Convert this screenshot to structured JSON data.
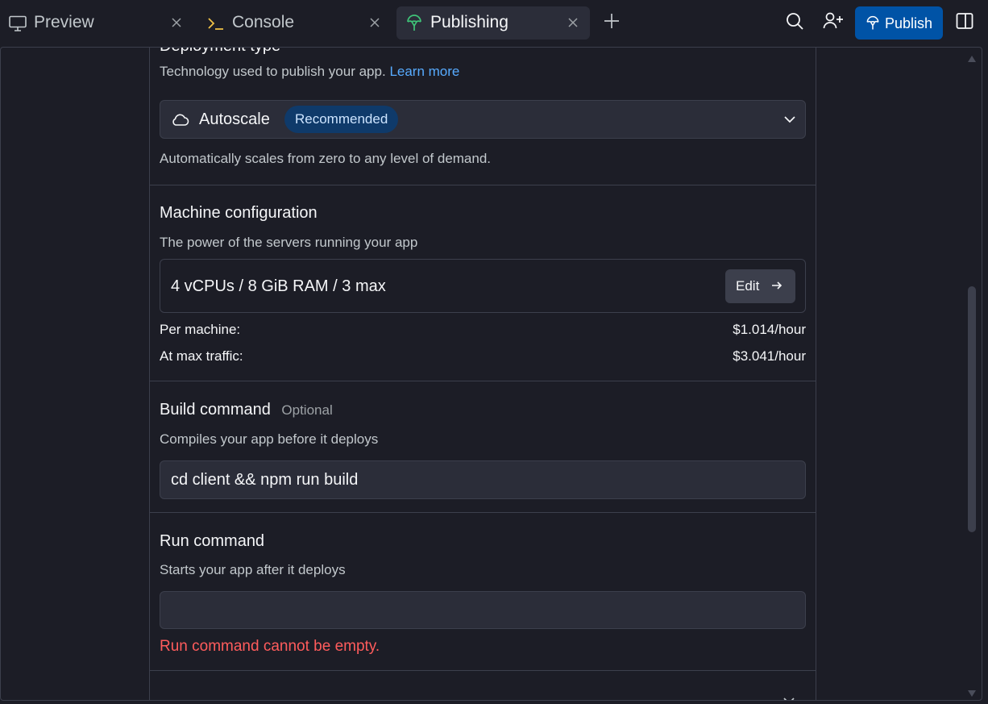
{
  "tabs": [
    {
      "label": "Preview",
      "icon": "monitor-icon",
      "active": false
    },
    {
      "label": "Console",
      "icon": "terminal-icon",
      "active": false
    },
    {
      "label": "Publishing",
      "icon": "publishing-icon",
      "active": true
    }
  ],
  "toolbar": {
    "publish_label": "Publish"
  },
  "deployment": {
    "title": "Deployment type",
    "description": "Technology used to publish your app.",
    "learn_more": "Learn more",
    "selected": "Autoscale",
    "badge": "Recommended",
    "note": "Automatically scales from zero to any level of demand."
  },
  "machine": {
    "title": "Machine configuration",
    "description": "The power of the servers running your app",
    "config": "4 vCPUs / 8 GiB RAM / 3 max",
    "edit_label": "Edit",
    "rows": [
      {
        "label": "Per machine:",
        "value": "$1.014/hour"
      },
      {
        "label": "At max traffic:",
        "value": "$3.041/hour"
      }
    ]
  },
  "build": {
    "title": "Build command",
    "optional": "Optional",
    "description": "Compiles your app before it deploys",
    "value": "cd client && npm run build"
  },
  "run": {
    "title": "Run command",
    "description": "Starts your app after it deploys",
    "value": "",
    "error": "Run command cannot be empty."
  },
  "colors": {
    "accent": "#0053a6",
    "link": "#57abff",
    "error": "#ff5c5c",
    "publishing_icon": "#3fc378"
  }
}
